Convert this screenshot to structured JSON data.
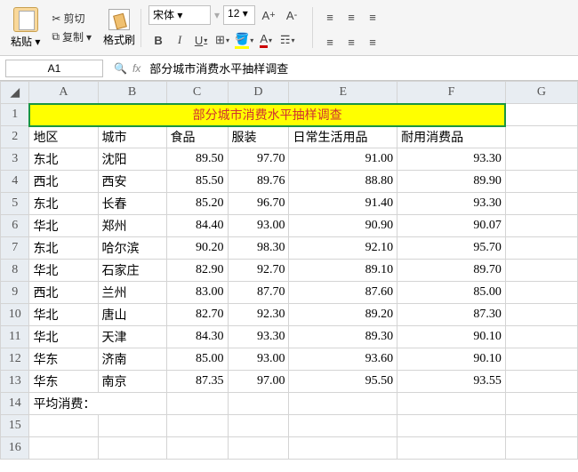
{
  "ribbon": {
    "paste_label": "粘贴",
    "cut_label": "剪切",
    "copy_label": "复制",
    "format_painter_label": "格式刷",
    "font_name": "宋体",
    "font_size": "12",
    "bold": "B",
    "italic": "I",
    "underline": "U"
  },
  "namebox": "A1",
  "formula": "部分城市消费水平抽样调查",
  "columns": [
    "A",
    "B",
    "C",
    "D",
    "E",
    "F",
    "G"
  ],
  "row_numbers": [
    1,
    2,
    3,
    4,
    5,
    6,
    7,
    8,
    9,
    10,
    11,
    12,
    13,
    14,
    15,
    16
  ],
  "chart_data": {
    "type": "table",
    "title": "部分城市消费水平抽样调查",
    "headers": [
      "地区",
      "城市",
      "食品",
      "服装",
      "日常生活用品",
      "耐用消费品"
    ],
    "rows": [
      {
        "area": "东北",
        "city": "沈阳",
        "food": "89.50",
        "cloth": "97.70",
        "daily": "91.00",
        "durable": "93.30"
      },
      {
        "area": "西北",
        "city": "西安",
        "food": "85.50",
        "cloth": "89.76",
        "daily": "88.80",
        "durable": "89.90"
      },
      {
        "area": "东北",
        "city": "长春",
        "food": "85.20",
        "cloth": "96.70",
        "daily": "91.40",
        "durable": "93.30"
      },
      {
        "area": "华北",
        "city": "郑州",
        "food": "84.40",
        "cloth": "93.00",
        "daily": "90.90",
        "durable": "90.07"
      },
      {
        "area": "东北",
        "city": "哈尔滨",
        "food": "90.20",
        "cloth": "98.30",
        "daily": "92.10",
        "durable": "95.70"
      },
      {
        "area": "华北",
        "city": "石家庄",
        "food": "82.90",
        "cloth": "92.70",
        "daily": "89.10",
        "durable": "89.70"
      },
      {
        "area": "西北",
        "city": "兰州",
        "food": "83.00",
        "cloth": "87.70",
        "daily": "87.60",
        "durable": "85.00"
      },
      {
        "area": "华北",
        "city": "唐山",
        "food": "82.70",
        "cloth": "92.30",
        "daily": "89.20",
        "durable": "87.30"
      },
      {
        "area": "华北",
        "city": "天津",
        "food": "84.30",
        "cloth": "93.30",
        "daily": "89.30",
        "durable": "90.10"
      },
      {
        "area": "华东",
        "city": "济南",
        "food": "85.00",
        "cloth": "93.00",
        "daily": "93.60",
        "durable": "90.10"
      },
      {
        "area": "华东",
        "city": "南京",
        "food": "87.35",
        "cloth": "97.00",
        "daily": "95.50",
        "durable": "93.55"
      }
    ],
    "footer_label": "平均消费："
  }
}
